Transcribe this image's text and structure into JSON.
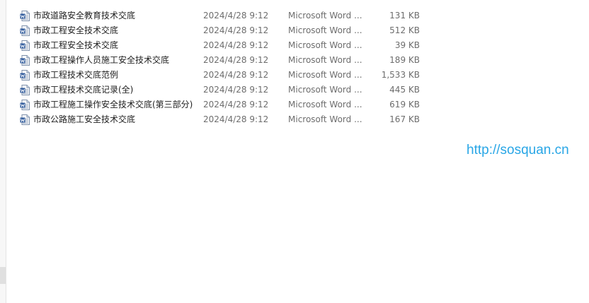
{
  "files": [
    {
      "name": "市政道路安全教育技术交底",
      "modified": "2024/4/28 9:12",
      "type": "Microsoft Word ...",
      "size": "131 KB",
      "icon": "word-document-icon"
    },
    {
      "name": "市政工程安全技术交底",
      "modified": "2024/4/28 9:12",
      "type": "Microsoft Word ...",
      "size": "512 KB",
      "icon": "word-document-icon"
    },
    {
      "name": "市政工程安全技术交底",
      "modified": "2024/4/28 9:12",
      "type": "Microsoft Word ...",
      "size": "39 KB",
      "icon": "word-document-icon"
    },
    {
      "name": "市政工程操作人员施工安全技术交底",
      "modified": "2024/4/28 9:12",
      "type": "Microsoft Word ...",
      "size": "189 KB",
      "icon": "word-document-icon"
    },
    {
      "name": "市政工程技术交底范例",
      "modified": "2024/4/28 9:12",
      "type": "Microsoft Word ...",
      "size": "1,533 KB",
      "icon": "word-document-icon"
    },
    {
      "name": "市政工程技术交底记录(全)",
      "modified": "2024/4/28 9:12",
      "type": "Microsoft Word ...",
      "size": "445 KB",
      "icon": "word-document-icon"
    },
    {
      "name": "市政工程施工操作安全技术交底(第三部分)",
      "modified": "2024/4/28 9:12",
      "type": "Microsoft Word ...",
      "size": "619 KB",
      "icon": "word-document-icon"
    },
    {
      "name": "市政公路施工安全技术交底",
      "modified": "2024/4/28 9:12",
      "type": "Microsoft Word ...",
      "size": "167 KB",
      "icon": "word-document-icon"
    }
  ],
  "watermark": "http://sosquan.cn",
  "colors": {
    "name_text": "#1e1e1e",
    "detail_text": "#6d6d6d",
    "watermark": "#29a6e6",
    "word_icon_blue": "#2b579a"
  }
}
